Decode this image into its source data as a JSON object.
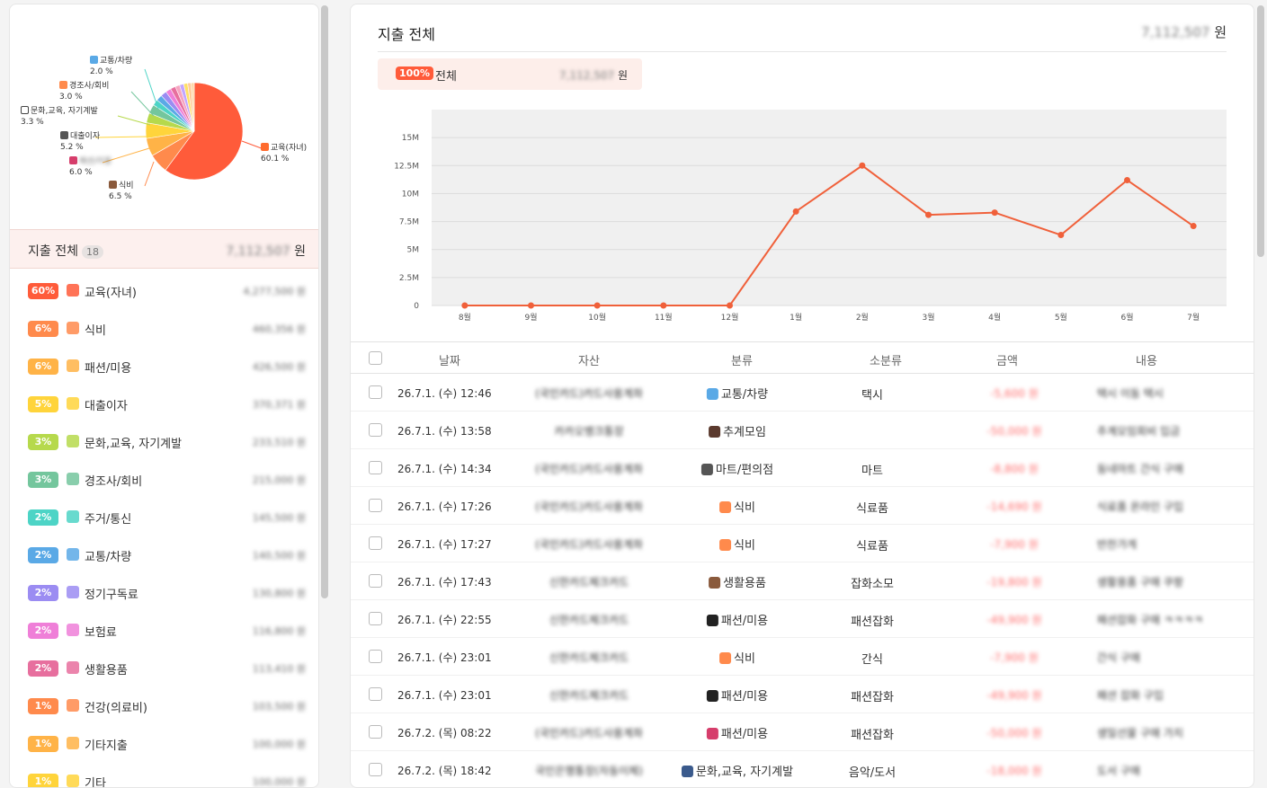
{
  "pie": {
    "slices": [
      {
        "name": "교육(자녀)",
        "pct": 60.1,
        "color": "#ff5b3a"
      },
      {
        "name": "식비",
        "pct": 6.5,
        "color": "#ff8a4c"
      },
      {
        "name": "패션/미용",
        "pct": 6.0,
        "color": "#ffb347"
      },
      {
        "name": "대출이자",
        "pct": 5.2,
        "color": "#ffd43b"
      },
      {
        "name": "문화,교육, 자기계발",
        "pct": 3.3,
        "color": "#b6d94c"
      },
      {
        "name": "경조사/회비",
        "pct": 3.0,
        "color": "#74c69d"
      },
      {
        "name": "교통/차량",
        "pct": 2.0,
        "color": "#4dd4c6"
      },
      {
        "name": "",
        "pct": 2.0,
        "color": "#5aa9e6"
      },
      {
        "name": "",
        "pct": 2.0,
        "color": "#9b8cf2"
      },
      {
        "name": "",
        "pct": 1.8,
        "color": "#ef7fd8"
      },
      {
        "name": "",
        "pct": 1.7,
        "color": "#e76f9e"
      },
      {
        "name": "",
        "pct": 1.5,
        "color": "#f6a5c0"
      },
      {
        "name": "",
        "pct": 1.4,
        "color": "#c3a6ff"
      },
      {
        "name": "",
        "pct": 1.3,
        "color": "#ffe066"
      },
      {
        "name": "",
        "pct": 1.2,
        "color": "#ffcc99"
      },
      {
        "name": "",
        "pct": 1.0,
        "color": "#ffd8a8"
      }
    ],
    "labels": [
      {
        "text": "교통/차량",
        "pct": "2.0 %"
      },
      {
        "text": "경조사/회비",
        "pct": "3.0 %"
      },
      {
        "text": "문화,교육, 자기계발",
        "pct": "3.3 %"
      },
      {
        "text": "대출이자",
        "pct": "5.2 %"
      },
      {
        "text": "패션/미용",
        "pct": "6.0 %"
      },
      {
        "text": "식비",
        "pct": "6.5 %"
      },
      {
        "text": "교육(자녀)",
        "pct": "60.1 %"
      }
    ]
  },
  "summary": {
    "title": "지출 전체",
    "count": "18",
    "amount": "7,112,507",
    "unit": "원"
  },
  "categories": [
    {
      "pct": "60%",
      "name": "교육(자녀)",
      "amount": "4,277,500 원",
      "color": "#ff5b3a"
    },
    {
      "pct": "6%",
      "name": "식비",
      "amount": "460,356 원",
      "color": "#ff8a4c"
    },
    {
      "pct": "6%",
      "name": "패션/미용",
      "amount": "426,500 원",
      "color": "#ffb347"
    },
    {
      "pct": "5%",
      "name": "대출이자",
      "amount": "370,371 원",
      "color": "#ffd43b"
    },
    {
      "pct": "3%",
      "name": "문화,교육, 자기계발",
      "amount": "233,510 원",
      "color": "#b6d94c"
    },
    {
      "pct": "3%",
      "name": "경조사/회비",
      "amount": "215,000 원",
      "color": "#74c69d"
    },
    {
      "pct": "2%",
      "name": "주거/통신",
      "amount": "145,500 원",
      "color": "#4dd4c6"
    },
    {
      "pct": "2%",
      "name": "교통/차량",
      "amount": "140,500 원",
      "color": "#5aa9e6"
    },
    {
      "pct": "2%",
      "name": "정기구독료",
      "amount": "130,800 원",
      "color": "#9b8cf2"
    },
    {
      "pct": "2%",
      "name": "보험료",
      "amount": "116,800 원",
      "color": "#ef7fd8"
    },
    {
      "pct": "2%",
      "name": "생활용품",
      "amount": "113,410 원",
      "color": "#e76f9e"
    },
    {
      "pct": "1%",
      "name": "건강(의료비)",
      "amount": "103,500 원",
      "color": "#ff8a4c"
    },
    {
      "pct": "1%",
      "name": "기타지출",
      "amount": "100,000 원",
      "color": "#ffb347"
    },
    {
      "pct": "1%",
      "name": "기타",
      "amount": "100,000 원",
      "color": "#ffd43b"
    }
  ],
  "right": {
    "title": "지출 전체",
    "total": "7,112,507",
    "unit": "원",
    "pill": {
      "badge": "100%",
      "label": "전체",
      "amount": "7,112,507"
    }
  },
  "chart_data": {
    "type": "line",
    "categories": [
      "8월",
      "9월",
      "10월",
      "11월",
      "12월",
      "1월",
      "2월",
      "3월",
      "4월",
      "5월",
      "6월",
      "7월"
    ],
    "values": [
      0,
      0,
      0,
      0,
      0,
      8400000,
      12500000,
      8100000,
      8300000,
      6300000,
      11200000,
      7100000
    ],
    "yticks": [
      "0",
      "2.5M",
      "5M",
      "7.5M",
      "10M",
      "12.5M",
      "15M"
    ],
    "ylim": [
      0,
      17500000
    ],
    "color": "#f0603a",
    "grid": true
  },
  "table": {
    "headers": [
      "날짜",
      "자산",
      "분류",
      "소분류",
      "금액",
      "내용"
    ],
    "rows": [
      {
        "date": "26.7.1. (수) 12:46",
        "asset": "(국민카드)카드사용계좌",
        "cat": "교통/차량",
        "catColor": "#5aa9e6",
        "sub": "택시",
        "amount": "-5,600 원",
        "memo": "택시 이동 택시"
      },
      {
        "date": "26.7.1. (수) 13:58",
        "asset": "카카오뱅크통장",
        "cat": "추계모임",
        "catColor": "#5b3a2e",
        "sub": "",
        "amount": "-50,000 원",
        "memo": "추계모임회비 입금"
      },
      {
        "date": "26.7.1. (수) 14:34",
        "asset": "(국민카드)카드사용계좌",
        "cat": "마트/편의점",
        "catColor": "#555555",
        "sub": "마트",
        "amount": "-8,800 원",
        "memo": "동네마트 간식 구매"
      },
      {
        "date": "26.7.1. (수) 17:26",
        "asset": "(국민카드)카드사용계좌",
        "cat": "식비",
        "catColor": "#ff8a4c",
        "sub": "식료품",
        "amount": "-14,690 원",
        "memo": "식료품 온라인 구입"
      },
      {
        "date": "26.7.1. (수) 17:27",
        "asset": "(국민카드)카드사용계좌",
        "cat": "식비",
        "catColor": "#ff8a4c",
        "sub": "식료품",
        "amount": "-7,900 원",
        "memo": "반찬가게"
      },
      {
        "date": "26.7.1. (수) 17:43",
        "asset": "신한카드체크카드",
        "cat": "생활용품",
        "catColor": "#8a5a3c",
        "sub": "잡화소모",
        "amount": "-19,800 원",
        "memo": "생활용품 구매 쿠팡"
      },
      {
        "date": "26.7.1. (수) 22:55",
        "asset": "신한카드체크카드",
        "cat": "패션/미용",
        "catColor": "#222222",
        "sub": "패션잡화",
        "amount": "-49,900 원",
        "memo": "패션잡화 구매 ㅋㅋㅋㅋ"
      },
      {
        "date": "26.7.1. (수) 23:01",
        "asset": "신한카드체크카드",
        "cat": "식비",
        "catColor": "#ff8a4c",
        "sub": "간식",
        "amount": "-7,900 원",
        "memo": "간식 구매"
      },
      {
        "date": "26.7.1. (수) 23:01",
        "asset": "신한카드체크카드",
        "cat": "패션/미용",
        "catColor": "#222222",
        "sub": "패션잡화",
        "amount": "-49,900 원",
        "memo": "패션 잡화 구입"
      },
      {
        "date": "26.7.2. (목) 08:22",
        "asset": "(국민카드)카드사용계좌",
        "cat": "패션/미용",
        "catColor": "#d63d6b",
        "sub": "패션잡화",
        "amount": "-50,000 원",
        "memo": "생일선물 구매 가치"
      },
      {
        "date": "26.7.2. (목) 18:42",
        "asset": "국민은행통장(자동이체)",
        "cat": "문화,교육, 자기계발",
        "catColor": "#3a5a8c",
        "sub": "음악/도서",
        "amount": "-18,000 원",
        "memo": "도서 구매"
      }
    ]
  }
}
